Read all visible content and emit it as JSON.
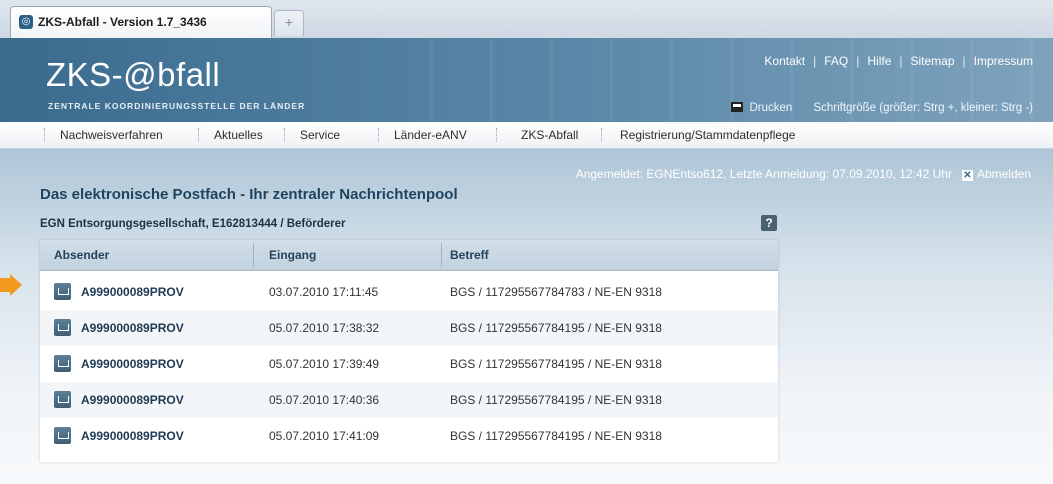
{
  "browser": {
    "tab_title": "ZKS-Abfall - Version 1.7_3436",
    "new_tab": "+"
  },
  "header": {
    "logo": "ZKS-@bfall",
    "logo_subtitle": "ZENTRALE KOORDINIERUNGSSTELLE DER LÄNDER",
    "top_links": [
      "Kontakt",
      "FAQ",
      "Hilfe",
      "Sitemap",
      "Impressum"
    ],
    "print_label": "Drucken",
    "font_size_hint": "Schriftgröße (größer: Strg +, kleiner: Strg -)"
  },
  "nav": {
    "items": [
      "Nachweisverfahren",
      "Aktuelles",
      "Service",
      "Länder-eANV",
      "ZKS-Abfall",
      "Registrierung/Stammdatenpflege"
    ]
  },
  "status": {
    "login_text": "Angemeldet: EGNEntso612, Letzte Anmeldung: 07.09.2010, 12:42 Uhr",
    "logout_label": "Abmelden"
  },
  "main": {
    "title": "Das elektronische Postfach - Ihr zentraler Nachrichtenpool",
    "company": "EGN Entsorgungsgesellschaft, E162813444 / Beförderer",
    "help_label": "?",
    "columns": [
      "Absender",
      "Eingang",
      "Betreff"
    ],
    "rows": [
      {
        "sender": "A999000089PROV",
        "date": "03.07.2010 17:11:45",
        "subject": "BGS / 117295567784783 / NE-EN 9318"
      },
      {
        "sender": "A999000089PROV",
        "date": "05.07.2010 17:38:32",
        "subject": "BGS / 117295567784195 / NE-EN 9318"
      },
      {
        "sender": "A999000089PROV",
        "date": "05.07.2010 17:39:49",
        "subject": "BGS / 117295567784195 / NE-EN 9318"
      },
      {
        "sender": "A999000089PROV",
        "date": "05.07.2010 17:40:36",
        "subject": "BGS / 117295567784195 / NE-EN 9318"
      },
      {
        "sender": "A999000089PROV",
        "date": "05.07.2010 17:41:09",
        "subject": "BGS / 117295567784195 / NE-EN 9318"
      }
    ]
  },
  "colors": {
    "header_blue": "#3a6b8e",
    "title_blue": "#1f4460",
    "arrow_orange": "#f39a1e"
  },
  "icons": {
    "favicon": "zks-favicon",
    "print": "printer-icon",
    "logout": "close-box-icon",
    "message": "envelope-download-icon",
    "pointer": "orange-arrow-icon"
  }
}
